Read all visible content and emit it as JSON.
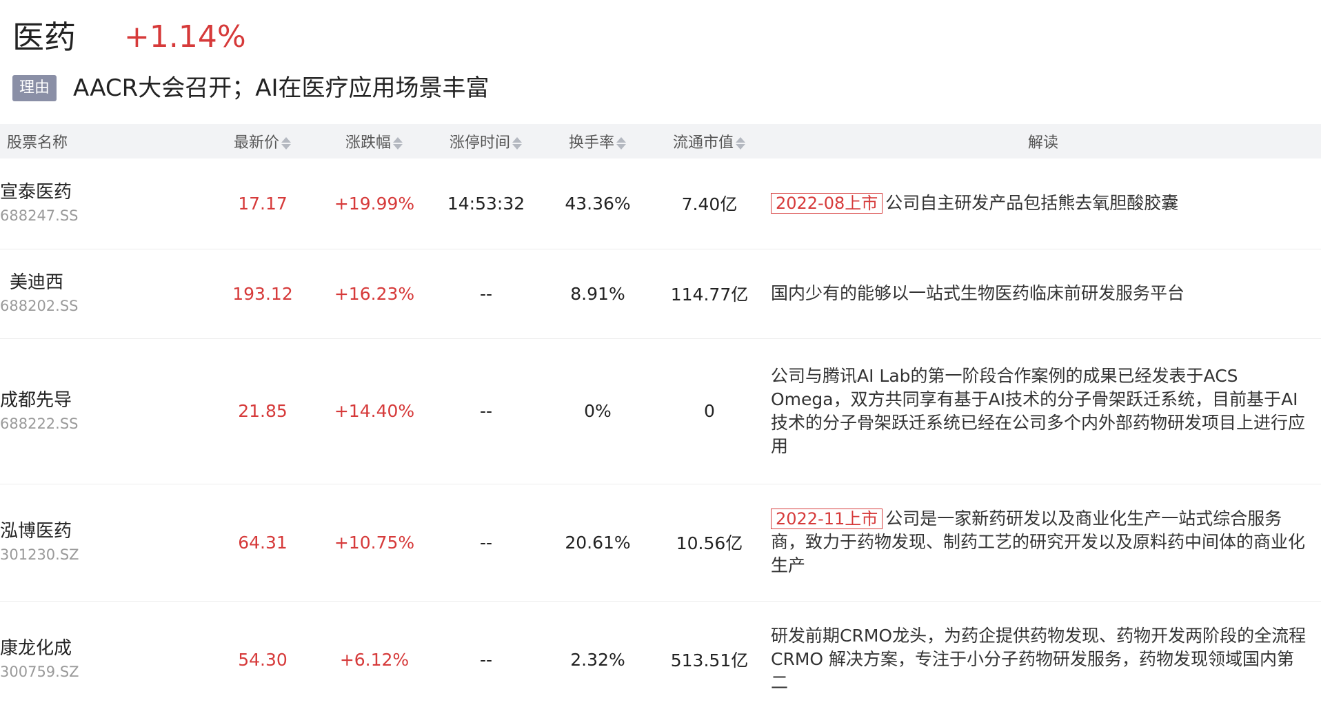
{
  "header": {
    "sector": "医药",
    "change": "+1.14%",
    "reason_label": "理由",
    "reason_text": "AACR大会召开；AI在医疗应用场景丰富"
  },
  "table": {
    "columns": {
      "name": "股票名称",
      "price": "最新价",
      "change": "涨跌幅",
      "limit_time": "涨停时间",
      "turnover": "换手率",
      "market_cap": "流通市值",
      "analysis": "解读"
    },
    "rows": [
      {
        "name": "宣泰医药",
        "code": "688247.SS",
        "price": "17.17",
        "change": "+19.99%",
        "limit_time": "14:53:32",
        "turnover": "43.36%",
        "market_cap": "7.40亿",
        "ipo_tag": "2022-08上市",
        "analysis": "公司自主研发产品包括熊去氧胆酸胶囊"
      },
      {
        "name": "美迪西",
        "code": "688202.SS",
        "price": "193.12",
        "change": "+16.23%",
        "limit_time": "--",
        "turnover": "8.91%",
        "market_cap": "114.77亿",
        "ipo_tag": "",
        "analysis": "国内少有的能够以一站式生物医药临床前研发服务平台"
      },
      {
        "name": "成都先导",
        "code": "688222.SS",
        "price": "21.85",
        "change": "+14.40%",
        "limit_time": "--",
        "turnover": "0%",
        "market_cap": "0",
        "ipo_tag": "",
        "analysis": "公司与腾讯AI Lab的第一阶段合作案例的成果已经发表于ACS Omega，双方共同享有基于AI技术的分子骨架跃迁系统，目前基于AI技术的分子骨架跃迁系统已经在公司多个内外部药物研发项目上进行应用"
      },
      {
        "name": "泓博医药",
        "code": "301230.SZ",
        "price": "64.31",
        "change": "+10.75%",
        "limit_time": "--",
        "turnover": "20.61%",
        "market_cap": "10.56亿",
        "ipo_tag": "2022-11上市",
        "analysis": "公司是一家新药研发以及商业化生产一站式综合服务商，致力于药物发现、制药工艺的研究开发以及原料药中间体的商业化生产"
      },
      {
        "name": "康龙化成",
        "code": "300759.SZ",
        "price": "54.30",
        "change": "+6.12%",
        "limit_time": "--",
        "turnover": "2.32%",
        "market_cap": "513.51亿",
        "ipo_tag": "",
        "analysis": "研发前期CRMO龙头，为药企提供药物发现、药物开发两阶段的全流程 CRMO 解决方案，专注于小分子药物研发服务，药物发现领域国内第二"
      }
    ]
  }
}
